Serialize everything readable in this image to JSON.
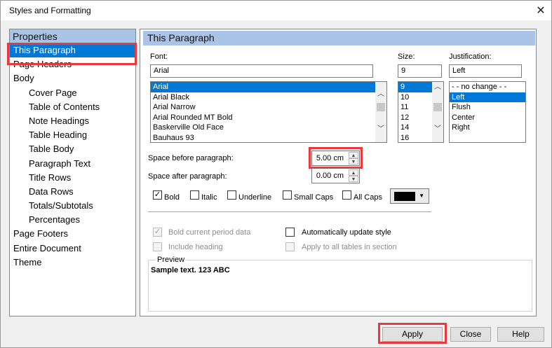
{
  "window": {
    "title": "Styles and Formatting",
    "close_glyph": "✕"
  },
  "properties": {
    "header": "Properties",
    "items": [
      {
        "label": "This Paragraph",
        "level": 0,
        "selected": true
      },
      {
        "label": "Page Headers",
        "level": 0
      },
      {
        "label": "Body",
        "level": 0
      },
      {
        "label": "Cover Page",
        "level": 1
      },
      {
        "label": "Table of Contents",
        "level": 1
      },
      {
        "label": "Note Headings",
        "level": 1
      },
      {
        "label": "Table Heading",
        "level": 1
      },
      {
        "label": "Table Body",
        "level": 1
      },
      {
        "label": "Paragraph Text",
        "level": 1
      },
      {
        "label": "Title Rows",
        "level": 1
      },
      {
        "label": "Data Rows",
        "level": 1
      },
      {
        "label": "Totals/Subtotals",
        "level": 1
      },
      {
        "label": "Percentages",
        "level": 1
      },
      {
        "label": "Page Footers",
        "level": 0
      },
      {
        "label": "Entire Document",
        "level": 0
      },
      {
        "label": "Theme",
        "level": 0
      }
    ]
  },
  "panel": {
    "header": "This Paragraph",
    "font": {
      "label": "Font:",
      "value": "Arial",
      "options": [
        "Arial",
        "Arial Black",
        "Arial Narrow",
        "Arial Rounded MT Bold",
        "Baskerville Old Face",
        "Bauhaus 93"
      ],
      "selected": "Arial"
    },
    "size": {
      "label": "Size:",
      "value": "9",
      "options": [
        "9",
        "10",
        "11",
        "12",
        "14",
        "16"
      ],
      "selected": "9"
    },
    "justification": {
      "label": "Justification:",
      "value": "Left",
      "options": [
        "- -  no change  - -",
        "Left",
        "Flush",
        "Center",
        "Right"
      ],
      "selected": "Left"
    },
    "space_before": {
      "label": "Space before paragraph:",
      "value": "5.00 cm"
    },
    "space_after": {
      "label": "Space after paragraph:",
      "value": "0.00 cm"
    },
    "styles": [
      {
        "label": "Bold",
        "checked": true
      },
      {
        "label": "Italic",
        "checked": false
      },
      {
        "label": "Underline",
        "checked": false
      },
      {
        "label": "Small Caps",
        "checked": false
      },
      {
        "label": "All Caps",
        "checked": false
      }
    ],
    "text_color": "#000000",
    "options": {
      "bold_current_period": {
        "label": "Bold current period data",
        "checked": true,
        "disabled": true
      },
      "include_heading": {
        "label": "Include heading",
        "checked": false,
        "disabled": true
      },
      "auto_update": {
        "label": "Automatically update style",
        "checked": false,
        "disabled": false
      },
      "apply_all_tables": {
        "label": "Apply to all tables in section",
        "checked": false,
        "disabled": true
      }
    },
    "preview": {
      "legend": "Preview",
      "sample": "Sample text. 123 ABC"
    }
  },
  "buttons": {
    "apply": "Apply",
    "close": "Close",
    "help": "Help"
  },
  "highlight_color": "#e8393c"
}
